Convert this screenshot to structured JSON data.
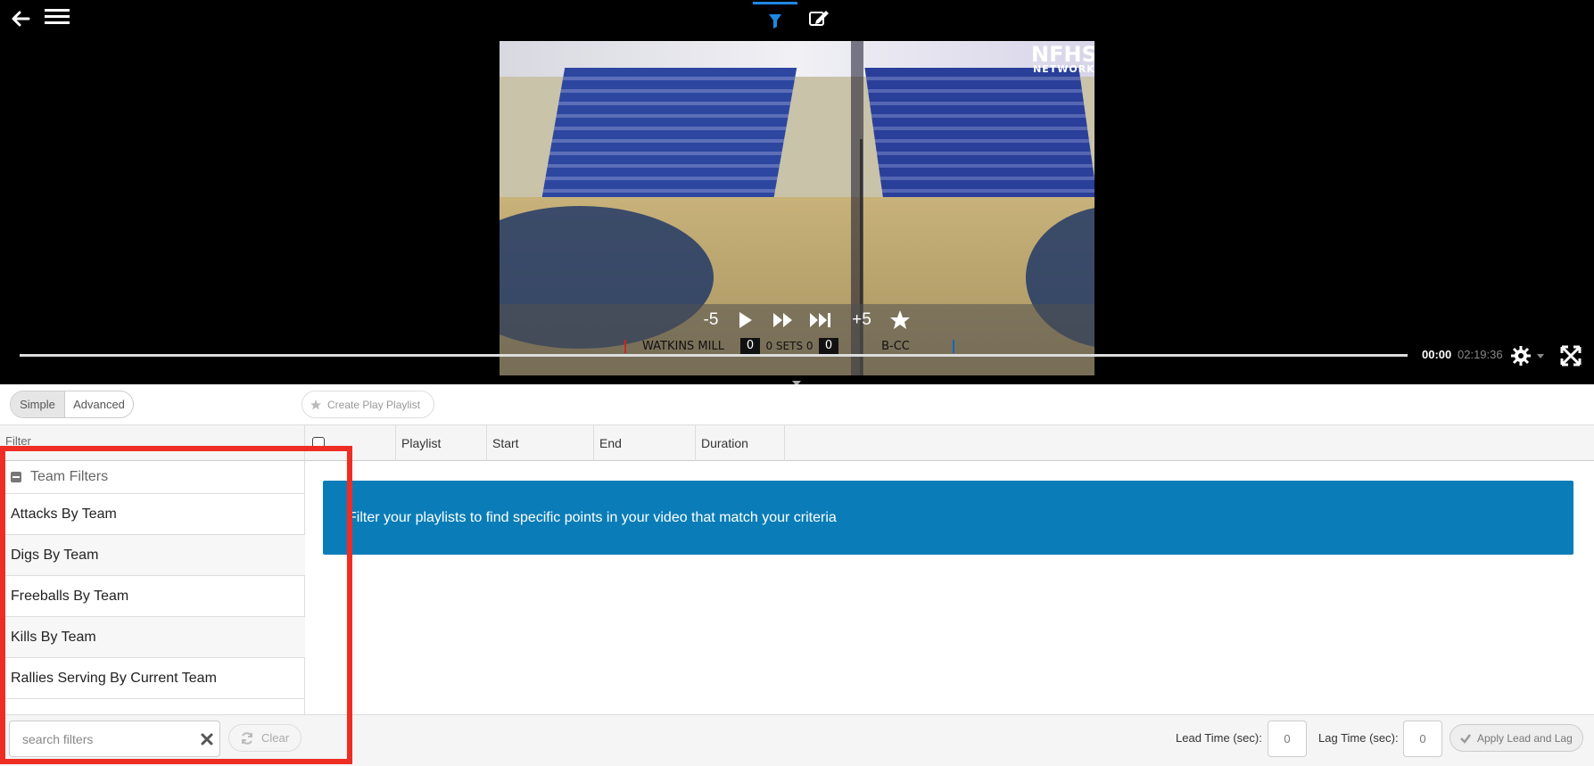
{
  "header": {
    "tabs": [
      {
        "name": "filter",
        "icon": "filter-icon",
        "active": true,
        "active_color": "#1e88e5"
      },
      {
        "name": "edit",
        "icon": "edit-icon",
        "active": false
      }
    ]
  },
  "video": {
    "watermark_main": "NFHS",
    "watermark_sub": "NETWORK",
    "controls": {
      "rewind_label": "-5",
      "forward_label": "+5"
    },
    "scoreboard": {
      "home_team": "WATKINS MILL",
      "home_score": "0",
      "sets_label": "0 SETS 0",
      "away_score": "0",
      "away_team": "B-CC"
    },
    "time_current": "00:00",
    "time_total": "02:19:36"
  },
  "toolbar": {
    "mode_simple": "Simple",
    "mode_advanced": "Advanced",
    "create_playlist": "Create Play Playlist"
  },
  "table": {
    "filter_header": "Filter",
    "columns": [
      "Playlist",
      "Start",
      "End",
      "Duration"
    ]
  },
  "filters": {
    "group_title": "Team Filters",
    "items": [
      "Attacks By Team",
      "Digs By Team",
      "Freeballs By Team",
      "Kills By Team",
      "Rallies Serving By Current Team"
    ]
  },
  "main": {
    "info_message": "Filter your playlists to find specific points in your video that match your criteria",
    "banner_color": "#0a7db8"
  },
  "bottom": {
    "search_placeholder": "search filters",
    "clear_label": "Clear",
    "lead_label": "Lead Time (sec):",
    "lead_value": "0",
    "lag_label": "Lag Time (sec):",
    "lag_value": "0",
    "apply_label": "Apply Lead and Lag"
  },
  "highlight_color": "#ee2d24"
}
